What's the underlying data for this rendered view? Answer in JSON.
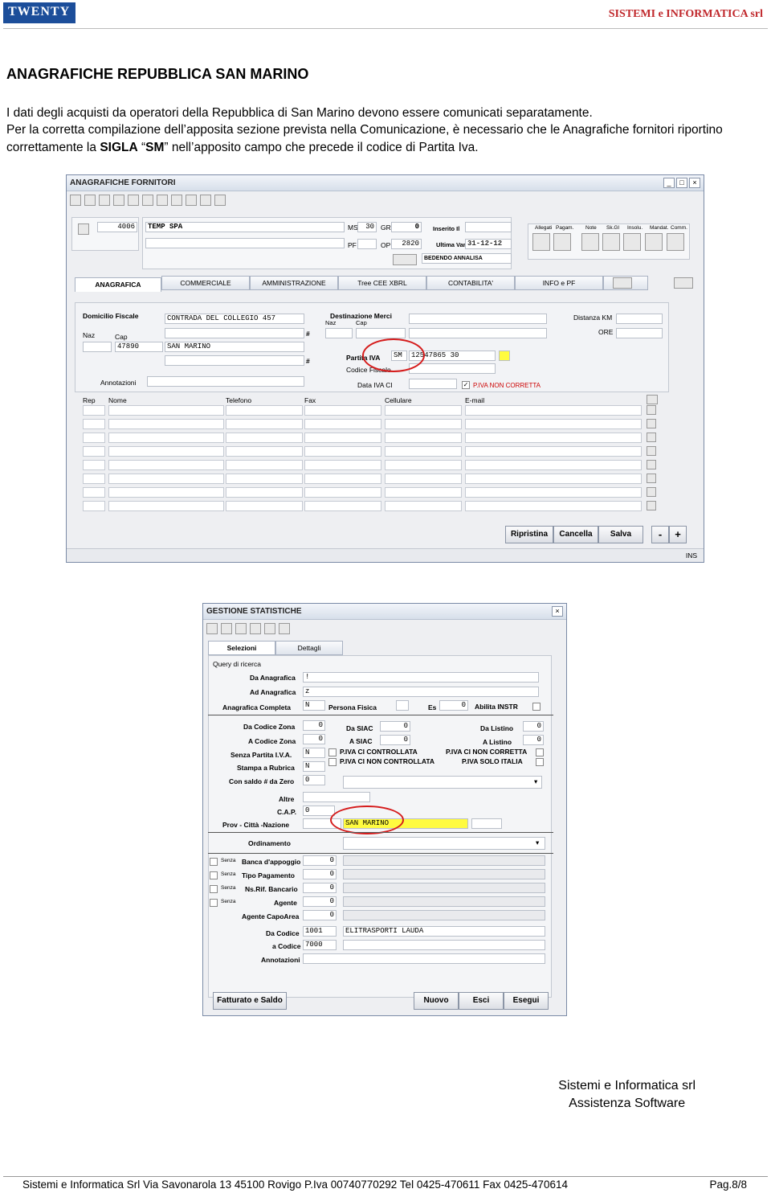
{
  "header": {
    "logo": "TWENTY",
    "brand": "SISTEMI e INFORMATICA srl"
  },
  "title": "ANAGRAFICHE REPUBBLICA SAN MARINO",
  "paragraph1": "I dati degli acquisti da operatori della Repubblica di San Marino devono essere comunicati separatamente.",
  "paragraph2a": "Per la corretta compilazione dell’apposita sezione prevista nella Comunicazione, è necessario che le Anagrafiche fornitori riportino correttamente la ",
  "paragraph2b": "SIGLA",
  "paragraph2c": " “",
  "paragraph2d": "SM",
  "paragraph2e": "” nell’apposito campo che precede il codice di Partita Iva.",
  "win1": {
    "title": "ANAGRAFICHE FORNITORI",
    "code": "4006",
    "name": "TEMP SPA",
    "ms_label": "MS",
    "ms": "30",
    "gr_label": "GR",
    "gr": "0",
    "pf_label": "PF",
    "op_label": "OP",
    "op": "2820",
    "inserito_label": "Inserito Il",
    "ultima_label": "Ultima Var",
    "ultima": "31-12-12",
    "user": "BEDENDO ANNALISA",
    "icons": [
      "Allegati",
      "Pagam.",
      "Note",
      "Sk.Gl",
      "Insolu.",
      "Mandat.",
      "Comm."
    ],
    "tabs": [
      "ANAGRAFICA",
      "COMMERCIALE",
      "AMMINISTRAZIONE",
      "Tree CEE XBRL",
      "CONTABILITA'",
      "INFO e PF"
    ],
    "domicilio_label": "Domicilio Fiscale",
    "address": "CONTRADA DEL COLLEGIO 457",
    "naz_label": "Naz",
    "cap_label": "Cap",
    "cap": "47890",
    "city": "SAN MARINO",
    "hash": "#",
    "destinazione_label": "Destinazione Merci",
    "distanza_label": "Distanza KM",
    "ore_label": "ORE",
    "piva_label": "Partita IVA",
    "piva_prefix": "SM",
    "piva": "12547865 30",
    "cf_label": "Codice Fiscale",
    "annotazioni_label": "Annotazioni",
    "data_iva_label": "Data IVA CI",
    "piva_warning": "P.IVA NON CORRETTA",
    "grid_headers": [
      "Rep",
      "Nome",
      "Telefono",
      "Fax",
      "Cellulare",
      "E-mail"
    ],
    "buttons": [
      "Ripristina",
      "Cancella",
      "Salva"
    ],
    "minus": "-",
    "plus": "+",
    "status": "INS"
  },
  "win2": {
    "title": "GESTIONE STATISTICHE",
    "tabs": [
      "Selezioni",
      "Dettagli"
    ],
    "query_label": "Query di ricerca",
    "da_anagrafica_label": "Da Anagrafica",
    "da_anagrafica": "!",
    "ad_anagrafica_label": "Ad Anagrafica",
    "ad_anagrafica": "z",
    "completa_label": "Anagrafica Completa",
    "completa": "N",
    "persona_label": "Persona Fisica",
    "es_label": "Es",
    "es": "0",
    "abilita_label": "Abilita INSTR",
    "da_zona_label": "Da Codice Zona",
    "da_zona": "0",
    "a_zona_label": "A Codice Zona",
    "a_zona": "0",
    "senza_piva_label": "Senza Partita I.V.A.",
    "senza_piva": "N",
    "stampa_label": "Stampa a Rubrica",
    "stampa": "N",
    "saldo_label": "Con saldo # da Zero",
    "saldo": "0",
    "da_siac_label": "Da SIAC",
    "da_siac": "0",
    "a_siac_label": "A SIAC",
    "a_siac": "0",
    "da_listino_label": "Da Listino",
    "da_listino": "0",
    "a_listino_label": "A Listino",
    "a_listino": "0",
    "chk1": "P.IVA CI CONTROLLATA",
    "chk2": "P.IVA CI NON CONTROLLATA",
    "chk3": "P.IVA CI NON CORRETTA",
    "chk4": "P.IVA SOLO ITALIA",
    "altre_label": "Altre",
    "cap_label": "C.A.P.",
    "cap": "0",
    "prov_label": "Prov - Città -Nazione",
    "prov": "SAN MARINO",
    "ordinamento_label": "Ordinamento",
    "senza_label": "Senza",
    "banca_label": "Banca d'appoggio",
    "banca": "0",
    "tipo_pag_label": "Tipo Pagamento",
    "tipo_pag": "0",
    "nsrif_label": "Ns.Rif. Bancario",
    "nsrif": "0",
    "agente_label": "Agente",
    "agente": "0",
    "capoarea_label": "Agente CapoArea",
    "capoarea": "0",
    "da_codice_label": "Da Codice",
    "da_codice": "1001",
    "da_codice_name": "ELITRASPORTI LAUDA",
    "a_codice_label": "a Codice",
    "a_codice": "7000",
    "annot_label": "Annotazioni",
    "buttons": [
      "Fatturato e Saldo",
      "Nuovo",
      "Esci",
      "Esegui"
    ]
  },
  "signature": {
    "line1": "Sistemi e Informatica srl",
    "line2": "Assistenza Software"
  },
  "footer": {
    "text": "Sistemi e Informatica Srl Via Savonarola 13  45100 Rovigo P.Iva 00740770292 Tel 0425-470611 Fax 0425-470614",
    "page": "Pag.8/8"
  }
}
